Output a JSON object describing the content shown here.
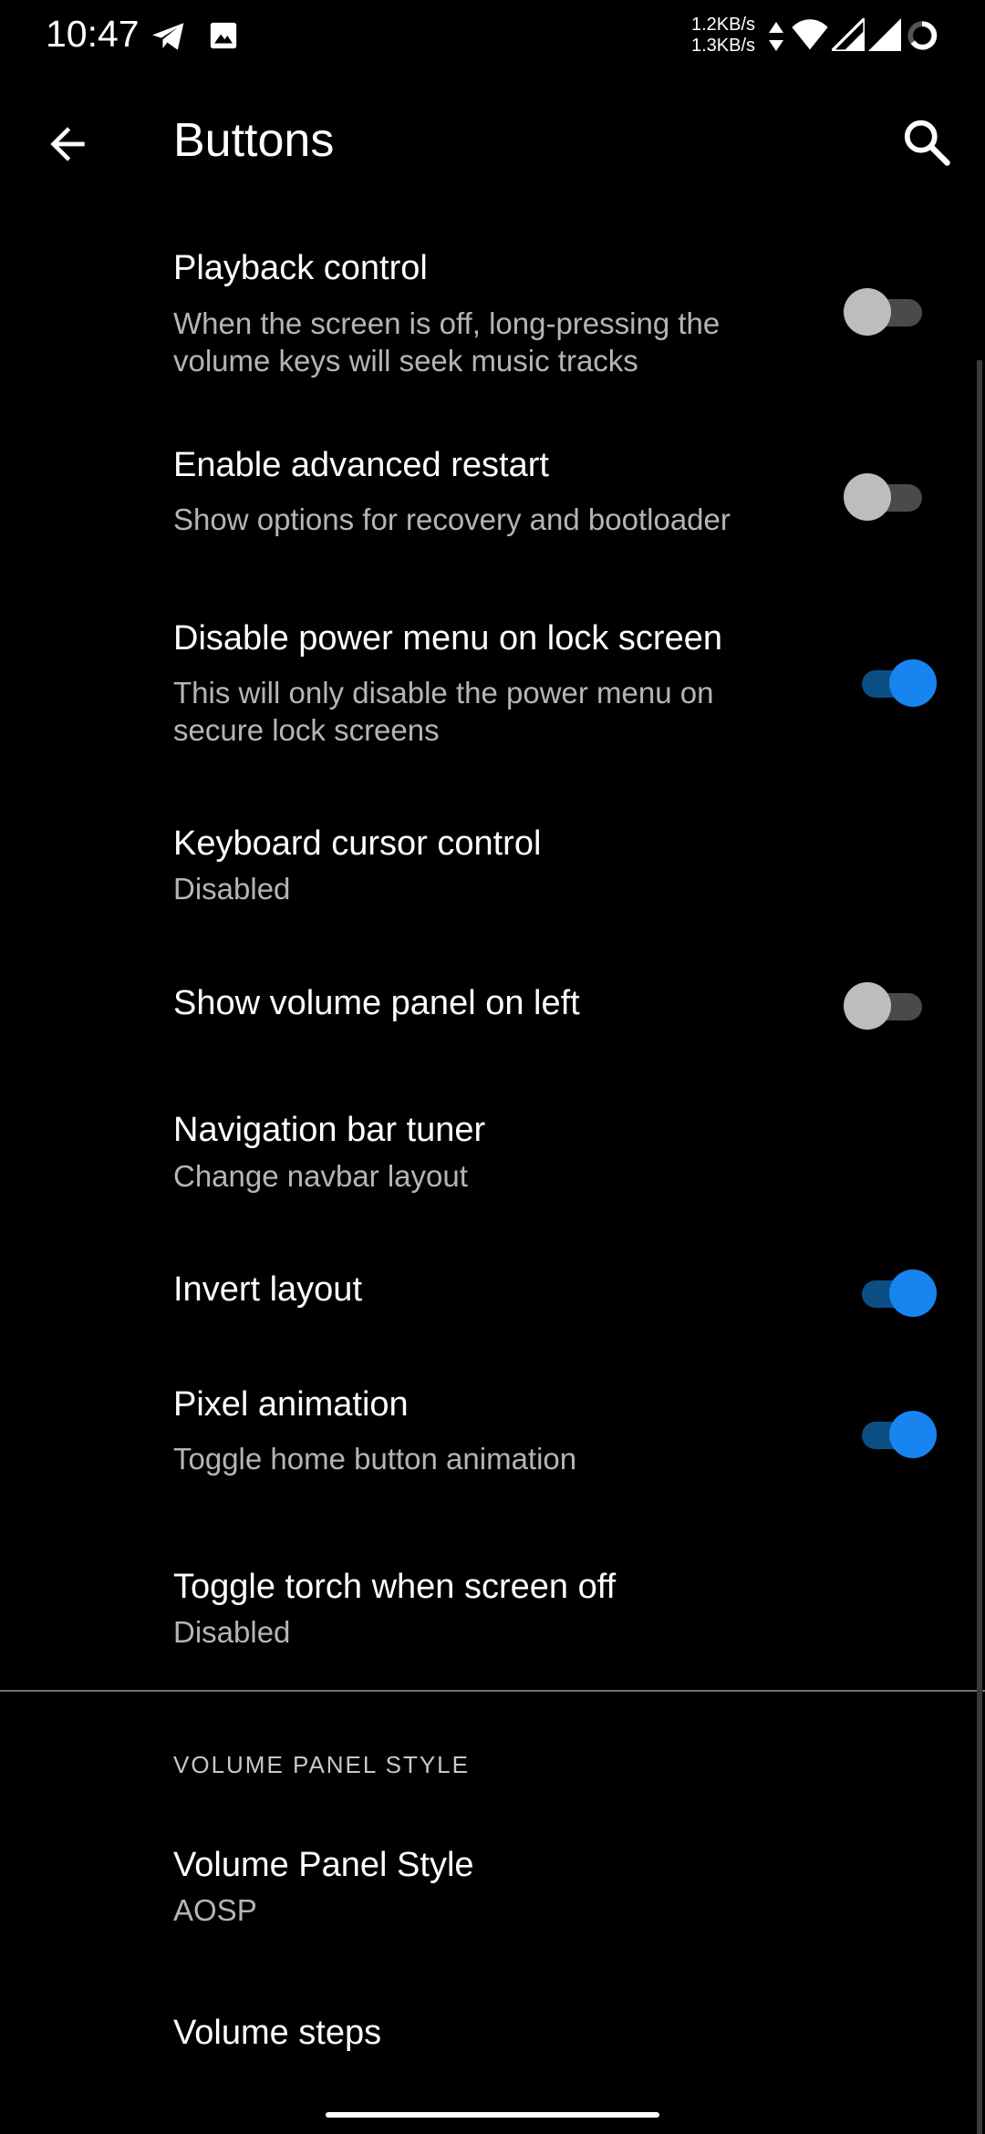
{
  "status_bar": {
    "time": "10:47",
    "net_up": "1.2KB/s",
    "net_down": "1.3KB/s",
    "icons": [
      "telegram-icon",
      "image-icon",
      "data-activity-icon",
      "wifi-icon",
      "signal-icon",
      "signal-icon",
      "battery-icon"
    ]
  },
  "app_bar": {
    "title": "Buttons"
  },
  "items": [
    {
      "title": "Playback control",
      "summary": "When the screen is off, long-pressing the volume keys will seek music tracks",
      "toggle": false
    },
    {
      "title": "Enable advanced restart",
      "summary": "Show options for recovery and bootloader",
      "toggle": false
    },
    {
      "title": "Disable power menu on lock screen",
      "summary": "This will only disable the power menu on secure lock screens",
      "toggle": true
    },
    {
      "title": "Keyboard cursor control",
      "summary": "Disabled"
    },
    {
      "title": "Show volume panel on left",
      "toggle": false
    },
    {
      "title": "Navigation bar tuner",
      "summary": "Change navbar layout"
    },
    {
      "title": "Invert layout",
      "toggle": true
    },
    {
      "title": "Pixel animation",
      "summary": "Toggle home button animation",
      "toggle": true
    },
    {
      "title": "Toggle torch when screen off",
      "summary": "Disabled"
    }
  ],
  "section_header": "VOLUME PANEL STYLE",
  "section_items": [
    {
      "title": "Volume Panel Style",
      "summary": "AOSP"
    },
    {
      "title": "Volume steps"
    }
  ],
  "colors": {
    "accent": "#1784f0",
    "background": "#000000",
    "summary_text": "#b5b5b5"
  }
}
